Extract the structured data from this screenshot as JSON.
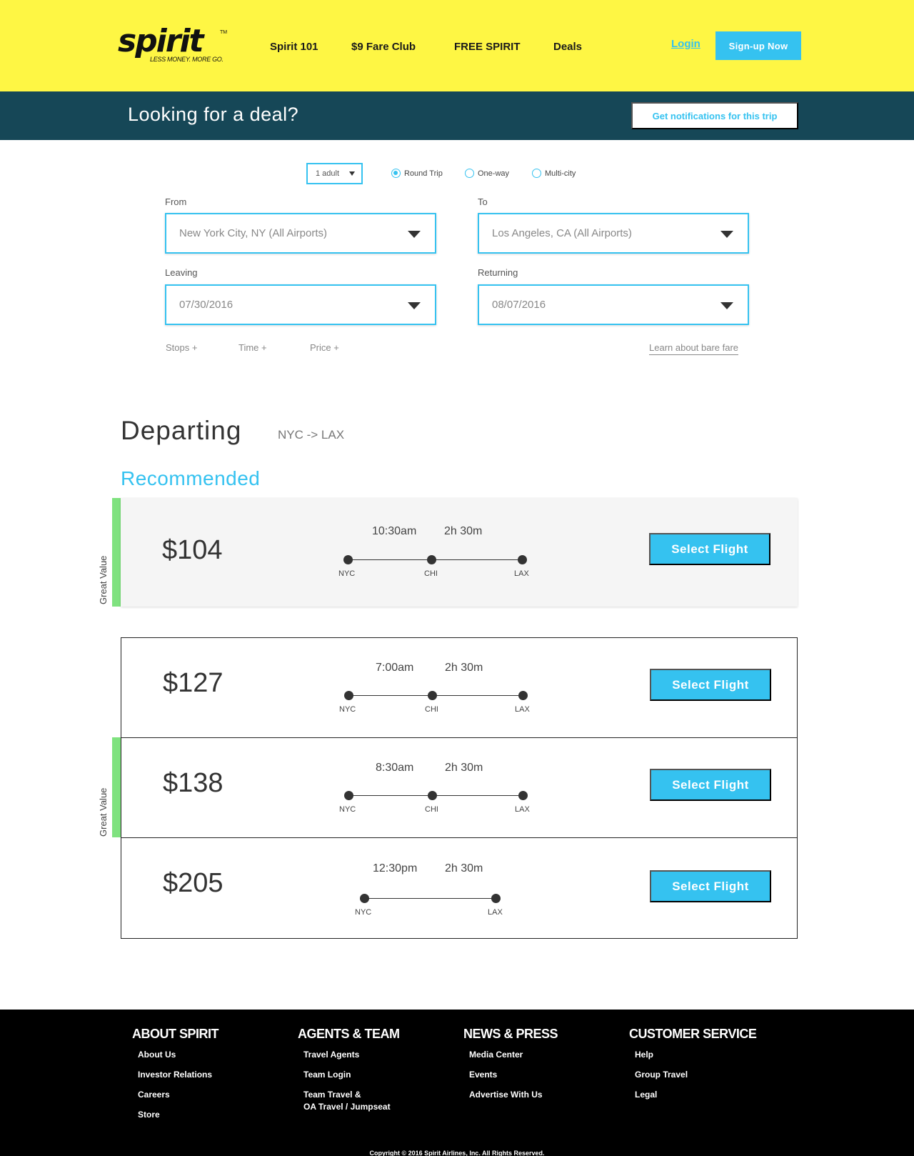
{
  "header": {
    "logo_word": "spirit",
    "logo_tm": "TM",
    "logo_tagline": "LESS MONEY. MORE GO.",
    "nav": [
      "Spirit 101",
      "$9 Fare Club",
      "FREE SPIRIT",
      "Deals"
    ],
    "login": "Login",
    "signup": "Sign-up Now"
  },
  "dealbar": {
    "title": "Looking for a deal?",
    "notify_button": "Get notifications for this trip"
  },
  "search": {
    "passengers": "1 adult",
    "trip_types": [
      {
        "label": "Round Trip",
        "selected": true
      },
      {
        "label": "One-way",
        "selected": false
      },
      {
        "label": "Multi-city",
        "selected": false
      }
    ],
    "from_label": "From",
    "from_value": "New York City, NY (All Airports)",
    "to_label": "To",
    "to_value": "Los Angeles, CA (All Airports)",
    "leaving_label": "Leaving",
    "leaving_value": "07/30/2016",
    "returning_label": "Returning",
    "returning_value": "08/07/2016",
    "filters": [
      "Stops +",
      "Time +",
      "Price +"
    ],
    "bare_fare_link": "Learn about bare fare"
  },
  "results": {
    "heading": "Departing",
    "route": "NYC -> LAX",
    "recommended_label": "Recommended",
    "great_value_label": "Great Value",
    "select_label": "Select Flight",
    "flights": [
      {
        "price": "$104",
        "time": "10:30am",
        "duration": "2h 30m",
        "stops": [
          "NYC",
          "CHI",
          "LAX"
        ],
        "great_value": true
      },
      {
        "price": "$127",
        "time": "7:00am",
        "duration": "2h 30m",
        "stops": [
          "NYC",
          "CHI",
          "LAX"
        ],
        "great_value": false
      },
      {
        "price": "$138",
        "time": "8:30am",
        "duration": "2h 30m",
        "stops": [
          "NYC",
          "CHI",
          "LAX"
        ],
        "great_value": true
      },
      {
        "price": "$205",
        "time": "12:30pm",
        "duration": "2h 30m",
        "stops": [
          "NYC",
          "LAX"
        ],
        "great_value": false
      }
    ]
  },
  "footer": {
    "columns": [
      {
        "heading": "ABOUT SPIRIT",
        "links": [
          "About Us",
          "Investor Relations",
          "Careers",
          "Store"
        ]
      },
      {
        "heading": "AGENTS & TEAM",
        "links": [
          "Travel Agents",
          "Team Login",
          "Team Travel &\nOA Travel / Jumpseat"
        ]
      },
      {
        "heading": "NEWS & PRESS",
        "links": [
          "Media Center",
          "Events",
          "Advertise With Us"
        ]
      },
      {
        "heading": "CUSTOMER SERVICE",
        "links": [
          "Help",
          "Group Travel",
          "Legal"
        ]
      }
    ],
    "copyright": "Copyright © 2016 Spirit Airlines, Inc. All Rights Reserved."
  },
  "colors": {
    "brand_yellow": "#fef644",
    "accent_blue": "#35c2f0",
    "deal_bar": "#164757",
    "great_value_green": "#7fe27f"
  }
}
